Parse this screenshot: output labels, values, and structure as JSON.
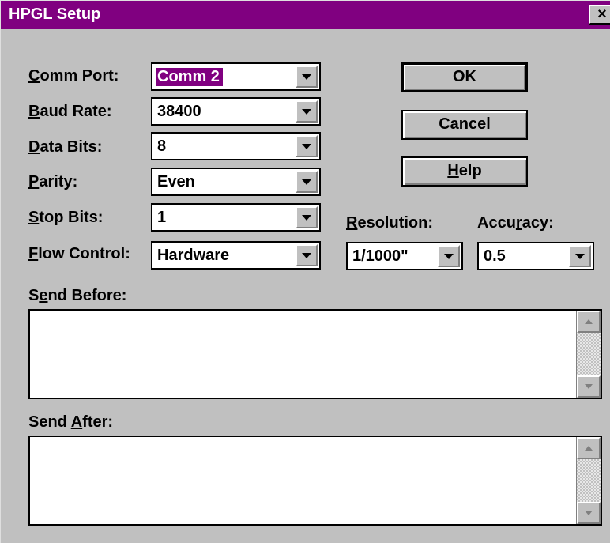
{
  "window": {
    "title": "HPGL Setup",
    "close_glyph": "×"
  },
  "colors": {
    "titlebar": "#800080",
    "face": "#c0c0c0",
    "selection": "#800080"
  },
  "fields": {
    "comm_port": {
      "label_pre": "",
      "label_key": "C",
      "label_post": "omm Port:",
      "value": "Comm 2"
    },
    "baud_rate": {
      "label_pre": "",
      "label_key": "B",
      "label_post": "aud Rate:",
      "value": "38400"
    },
    "data_bits": {
      "label_pre": "",
      "label_key": "D",
      "label_post": "ata Bits:",
      "value": "8"
    },
    "parity": {
      "label_pre": "",
      "label_key": "P",
      "label_post": "arity:",
      "value": "Even"
    },
    "stop_bits": {
      "label_pre": "",
      "label_key": "S",
      "label_post": "top Bits:",
      "value": "1"
    },
    "flow_control": {
      "label_pre": "",
      "label_key": "F",
      "label_post": "low Control:",
      "value": "Hardware"
    },
    "resolution": {
      "label_pre": "",
      "label_key": "R",
      "label_post": "esolution:",
      "value": "1/1000\""
    },
    "accuracy": {
      "label_pre": "Accu",
      "label_key": "r",
      "label_post": "acy:",
      "value": "0.5"
    }
  },
  "buttons": {
    "ok": {
      "pre": "OK",
      "key": "",
      "post": ""
    },
    "cancel": {
      "pre": "Cancel",
      "key": "",
      "post": ""
    },
    "help": {
      "pre": "",
      "key": "H",
      "post": "elp"
    }
  },
  "send_before": {
    "label_pre": "S",
    "label_key": "e",
    "label_post": "nd Before:",
    "value": ""
  },
  "send_after": {
    "label_pre": "Send ",
    "label_key": "A",
    "label_post": "fter:",
    "value": ""
  },
  "icons": {
    "dropdown": "chevron-down-icon",
    "scroll_up": "scroll-up-arrow-icon",
    "scroll_down": "scroll-down-arrow-icon"
  }
}
